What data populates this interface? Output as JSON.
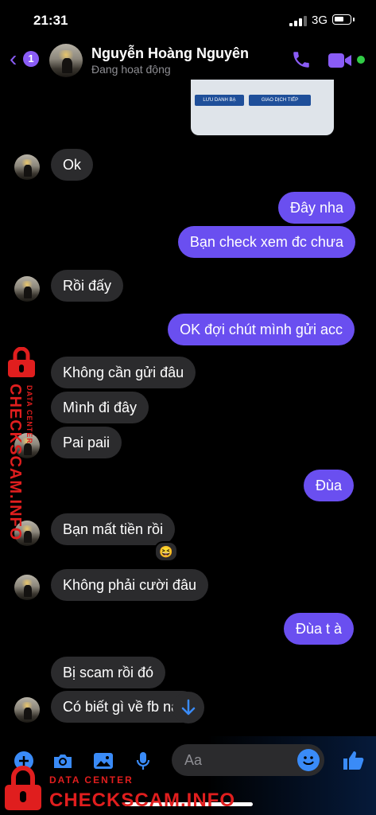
{
  "status_bar": {
    "time": "21:31",
    "network": "3G"
  },
  "header": {
    "back_badge": "1",
    "contact_name": "Nguyễn Hoàng Nguyên",
    "contact_status": "Đang hoạt động"
  },
  "preview": {
    "button_left": "LƯU DANH BẠ",
    "button_right": "GIAO DỊCH TIẾP"
  },
  "messages": [
    {
      "dir": "in",
      "text": "Ok"
    },
    {
      "dir": "out",
      "text": "Đây nha"
    },
    {
      "dir": "out",
      "text": "Bạn check xem đc chưa"
    },
    {
      "dir": "in",
      "text": "Rồi đấy"
    },
    {
      "dir": "out",
      "text": "OK đợi chút mình gửi acc"
    },
    {
      "dir": "in",
      "text": "Không cần gửi đâu"
    },
    {
      "dir": "in",
      "text": "Mình đi đây"
    },
    {
      "dir": "in",
      "text": "Pai paii"
    },
    {
      "dir": "out",
      "text": "Đùa"
    },
    {
      "dir": "in",
      "text": "Bạn mất tiền rồi"
    },
    {
      "dir": "in",
      "text": "Không phải cười đâu"
    },
    {
      "dir": "out",
      "text": "Đùa t à"
    },
    {
      "dir": "in",
      "text": "Bị scam rồi đó"
    },
    {
      "dir": "in",
      "text": "Có biết gì về fb       nay"
    }
  ],
  "reaction": "😆",
  "composer": {
    "placeholder": "Aa"
  },
  "watermark": {
    "label": "DATA CENTER",
    "brand": "CHECKSCAM.INFO"
  },
  "colors": {
    "accent": "#8a5cf6",
    "outgoing_bubble": "#6a4ff0",
    "incoming_bubble": "#2b2b2d",
    "watermark": "#e01e1e"
  }
}
